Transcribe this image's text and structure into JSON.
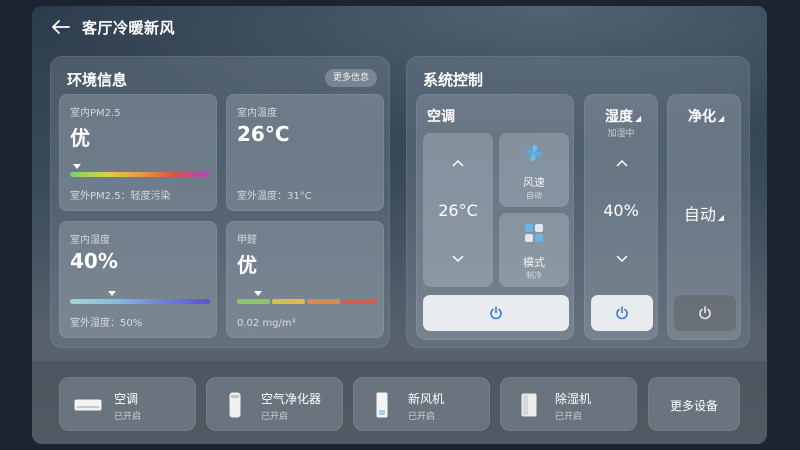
{
  "header": {
    "title": "客厅冷暖新风",
    "back_icon": "arrow-left-icon"
  },
  "env": {
    "title": "环境信息",
    "more_label": "更多信息",
    "pm25": {
      "label": "室内PM2.5",
      "value": "优",
      "sub": "室外PM2.5：轻度污染",
      "level": 0.05
    },
    "temp": {
      "label": "室内温度",
      "value": "26°C",
      "sub": "室外温度：31°C"
    },
    "humidity": {
      "label": "室内湿度",
      "value": "40%",
      "sub": "室外湿度：50%",
      "level": 0.3
    },
    "formaldehyde": {
      "label": "甲醛",
      "value": "优",
      "sub": "0.02 mg/m³",
      "level": 0.15
    }
  },
  "control": {
    "title": "系统控制",
    "ac": {
      "title": "空调",
      "temp": "26°C",
      "fan_label": "风速",
      "fan_value": "自动",
      "mode_label": "模式",
      "mode_value": "制冷"
    },
    "humid": {
      "title": "湿度",
      "status": "加湿中",
      "value": "40%"
    },
    "purify": {
      "title": "净化",
      "value": "自动"
    }
  },
  "devices": [
    {
      "name": "空调",
      "status": "已开启",
      "icon": "air-conditioner-icon"
    },
    {
      "name": "空气净化器",
      "status": "已开启",
      "icon": "air-purifier-icon"
    },
    {
      "name": "新风机",
      "status": "已开启",
      "icon": "fresh-air-icon"
    },
    {
      "name": "除湿机",
      "status": "已开启",
      "icon": "dehumidifier-icon"
    }
  ],
  "more_devices_label": "更多设备",
  "colors": {
    "power_active": "#3a78d8",
    "power_bg": "#e9ecef"
  }
}
